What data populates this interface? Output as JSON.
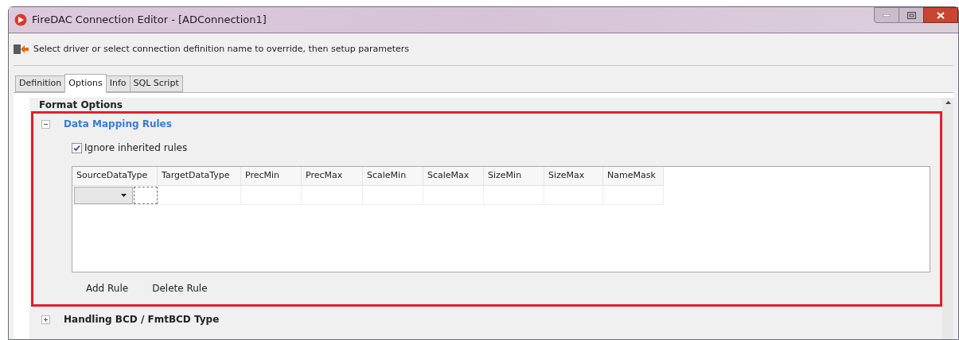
{
  "window": {
    "title": "FireDAC Connection Editor - [ADConnection1]"
  },
  "header": {
    "text": "Select driver or select connection definition name to override, then setup parameters"
  },
  "tabs": [
    {
      "label": "Definition",
      "selected": false
    },
    {
      "label": "Options",
      "selected": true
    },
    {
      "label": "Info",
      "selected": false
    },
    {
      "label": "SQL Script",
      "selected": false
    }
  ],
  "category": {
    "title": "Format Options"
  },
  "groups": [
    {
      "title": "Data Mapping Rules",
      "expanded": true,
      "highlighted": true,
      "checkbox": {
        "label": "Ignore inherited rules",
        "checked": true
      },
      "grid": {
        "columns": [
          "SourceDataType",
          "TargetDataType",
          "PrecMin",
          "PrecMax",
          "ScaleMin",
          "ScaleMax",
          "SizeMin",
          "SizeMax",
          "NameMask"
        ]
      },
      "buttons": [
        "Add Rule",
        "Delete Rule"
      ]
    },
    {
      "title": "Handling BCD / FmtBCD Type",
      "expanded": false,
      "highlighted": false
    }
  ]
}
